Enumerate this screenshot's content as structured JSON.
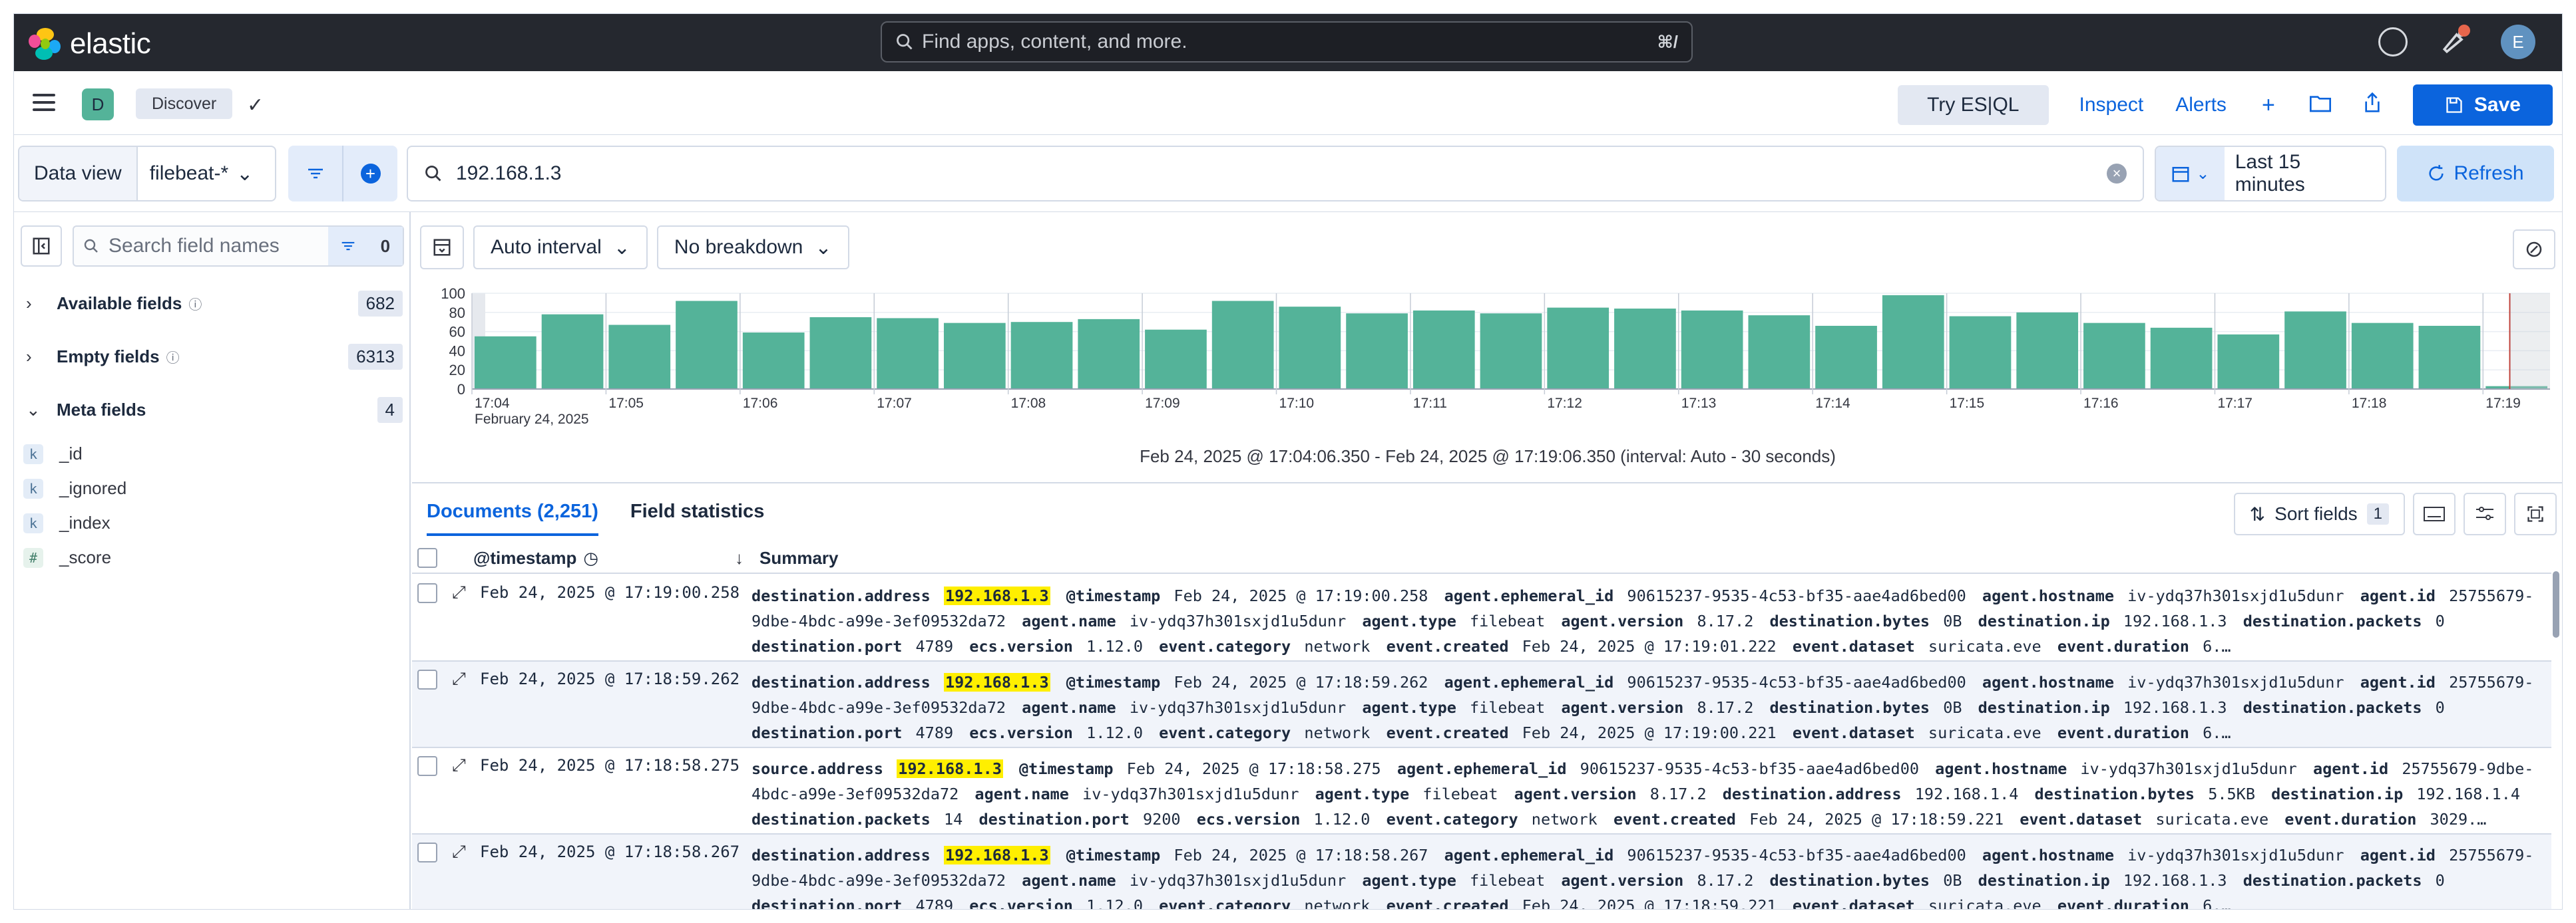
{
  "header": {
    "brand": "elastic",
    "search_placeholder": "Find apps, content, and more.",
    "search_shortcut": "⌘/",
    "avatar_initial": "E"
  },
  "appbar": {
    "space_initial": "D",
    "breadcrumb": "Discover",
    "esql_label": "Try ES|QL",
    "inspect_label": "Inspect",
    "alerts_label": "Alerts",
    "save_label": "Save"
  },
  "query": {
    "data_view_label": "Data view",
    "data_view_value": "filebeat-*",
    "query_text": "192.168.1.3",
    "time_range": "Last 15 minutes",
    "refresh_label": "Refresh"
  },
  "sidebar": {
    "search_placeholder": "Search field names",
    "filter_count": "0",
    "groups": [
      {
        "label": "Available fields",
        "count": "682"
      },
      {
        "label": "Empty fields",
        "count": "6313"
      },
      {
        "label": "Meta fields",
        "count": "4"
      }
    ],
    "meta_fields": [
      {
        "name": "_id",
        "type": "k"
      },
      {
        "name": "_ignored",
        "type": "k"
      },
      {
        "name": "_index",
        "type": "k"
      },
      {
        "name": "_score",
        "type": "#"
      }
    ]
  },
  "histogram": {
    "interval_label": "Auto interval",
    "breakdown_label": "No breakdown",
    "caption": "Feb 24, 2025 @ 17:04:06.350 - Feb 24, 2025 @ 17:19:06.350 (interval: Auto - 30 seconds)"
  },
  "chart_data": {
    "type": "bar",
    "color": "#54b399",
    "ylim": [
      0,
      100
    ],
    "yticks": [
      0,
      20,
      40,
      60,
      80,
      100
    ],
    "x_start_label": "February 24, 2025",
    "tick_labels": [
      "17:04",
      "17:05",
      "17:06",
      "17:07",
      "17:08",
      "17:09",
      "17:10",
      "17:11",
      "17:12",
      "17:13",
      "17:14",
      "17:15",
      "17:16",
      "17:17",
      "17:18",
      "17:19"
    ],
    "values": [
      55,
      78,
      67,
      92,
      59,
      75,
      74,
      69,
      70,
      73,
      62,
      92,
      86,
      79,
      82,
      79,
      85,
      84,
      82,
      77,
      66,
      98,
      76,
      80,
      69,
      64,
      57,
      81,
      69,
      66,
      3
    ]
  },
  "documents": {
    "tab_documents": "Documents (2,251)",
    "tab_stats": "Field statistics",
    "sort_label": "Sort fields",
    "sort_count": "1",
    "col_timestamp": "@timestamp",
    "col_summary": "Summary",
    "rows": [
      {
        "timestamp": "Feb 24, 2025 @ 17:19:00.258",
        "fields": [
          [
            "destination.address",
            "192.168.1.3",
            true
          ],
          [
            "@timestamp",
            "Feb 24, 2025 @ 17:19:00.258",
            false
          ],
          [
            "agent.ephemeral_id",
            "90615237-9535-4c53-bf35-aae4ad6bed00",
            false
          ],
          [
            "agent.hostname",
            "iv-ydq37h301sxjd1u5dunr",
            false
          ],
          [
            "agent.id",
            "25755679-9dbe-4bdc-a99e-3ef09532da72",
            false
          ],
          [
            "agent.name",
            "iv-ydq37h301sxjd1u5dunr",
            false
          ],
          [
            "agent.type",
            "filebeat",
            false
          ],
          [
            "agent.version",
            "8.17.2",
            false
          ],
          [
            "destination.bytes",
            "0B",
            false
          ],
          [
            "destination.ip",
            "192.168.1.3",
            false
          ],
          [
            "destination.packets",
            "0",
            false
          ],
          [
            "destination.port",
            "4789",
            false
          ],
          [
            "ecs.version",
            "1.12.0",
            false
          ],
          [
            "event.category",
            "network",
            false
          ],
          [
            "event.created",
            "Feb 24, 2025 @ 17:19:01.222",
            false
          ],
          [
            "event.dataset",
            "suricata.eve",
            false
          ],
          [
            "event.duration",
            "6.…",
            false
          ]
        ]
      },
      {
        "timestamp": "Feb 24, 2025 @ 17:18:59.262",
        "fields": [
          [
            "destination.address",
            "192.168.1.3",
            true
          ],
          [
            "@timestamp",
            "Feb 24, 2025 @ 17:18:59.262",
            false
          ],
          [
            "agent.ephemeral_id",
            "90615237-9535-4c53-bf35-aae4ad6bed00",
            false
          ],
          [
            "agent.hostname",
            "iv-ydq37h301sxjd1u5dunr",
            false
          ],
          [
            "agent.id",
            "25755679-9dbe-4bdc-a99e-3ef09532da72",
            false
          ],
          [
            "agent.name",
            "iv-ydq37h301sxjd1u5dunr",
            false
          ],
          [
            "agent.type",
            "filebeat",
            false
          ],
          [
            "agent.version",
            "8.17.2",
            false
          ],
          [
            "destination.bytes",
            "0B",
            false
          ],
          [
            "destination.ip",
            "192.168.1.3",
            false
          ],
          [
            "destination.packets",
            "0",
            false
          ],
          [
            "destination.port",
            "4789",
            false
          ],
          [
            "ecs.version",
            "1.12.0",
            false
          ],
          [
            "event.category",
            "network",
            false
          ],
          [
            "event.created",
            "Feb 24, 2025 @ 17:19:00.221",
            false
          ],
          [
            "event.dataset",
            "suricata.eve",
            false
          ],
          [
            "event.duration",
            "6.…",
            false
          ]
        ]
      },
      {
        "timestamp": "Feb 24, 2025 @ 17:18:58.275",
        "fields": [
          [
            "source.address",
            "192.168.1.3",
            true
          ],
          [
            "@timestamp",
            "Feb 24, 2025 @ 17:18:58.275",
            false
          ],
          [
            "agent.ephemeral_id",
            "90615237-9535-4c53-bf35-aae4ad6bed00",
            false
          ],
          [
            "agent.hostname",
            "iv-ydq37h301sxjd1u5dunr",
            false
          ],
          [
            "agent.id",
            "25755679-9dbe-4bdc-a99e-3ef09532da72",
            false
          ],
          [
            "agent.name",
            "iv-ydq37h301sxjd1u5dunr",
            false
          ],
          [
            "agent.type",
            "filebeat",
            false
          ],
          [
            "agent.version",
            "8.17.2",
            false
          ],
          [
            "destination.address",
            "192.168.1.4",
            false
          ],
          [
            "destination.bytes",
            "5.5KB",
            false
          ],
          [
            "destination.ip",
            "192.168.1.4",
            false
          ],
          [
            "destination.packets",
            "14",
            false
          ],
          [
            "destination.port",
            "9200",
            false
          ],
          [
            "ecs.version",
            "1.12.0",
            false
          ],
          [
            "event.category",
            "network",
            false
          ],
          [
            "event.created",
            "Feb 24, 2025 @ 17:18:59.221",
            false
          ],
          [
            "event.dataset",
            "suricata.eve",
            false
          ],
          [
            "event.duration",
            "3029.…",
            false
          ]
        ]
      },
      {
        "timestamp": "Feb 24, 2025 @ 17:18:58.267",
        "fields": [
          [
            "destination.address",
            "192.168.1.3",
            true
          ],
          [
            "@timestamp",
            "Feb 24, 2025 @ 17:18:58.267",
            false
          ],
          [
            "agent.ephemeral_id",
            "90615237-9535-4c53-bf35-aae4ad6bed00",
            false
          ],
          [
            "agent.hostname",
            "iv-ydq37h301sxjd1u5dunr",
            false
          ],
          [
            "agent.id",
            "25755679-9dbe-4bdc-a99e-3ef09532da72",
            false
          ],
          [
            "agent.name",
            "iv-ydq37h301sxjd1u5dunr",
            false
          ],
          [
            "agent.type",
            "filebeat",
            false
          ],
          [
            "agent.version",
            "8.17.2",
            false
          ],
          [
            "destination.bytes",
            "0B",
            false
          ],
          [
            "destination.ip",
            "192.168.1.3",
            false
          ],
          [
            "destination.packets",
            "0",
            false
          ],
          [
            "destination.port",
            "4789",
            false
          ],
          [
            "ecs.version",
            "1.12.0",
            false
          ],
          [
            "event.category",
            "network",
            false
          ],
          [
            "event.created",
            "Feb 24, 2025 @ 17:18:59.221",
            false
          ],
          [
            "event.dataset",
            "suricata.eve",
            false
          ],
          [
            "event.duration",
            "6.…",
            false
          ]
        ]
      }
    ]
  }
}
